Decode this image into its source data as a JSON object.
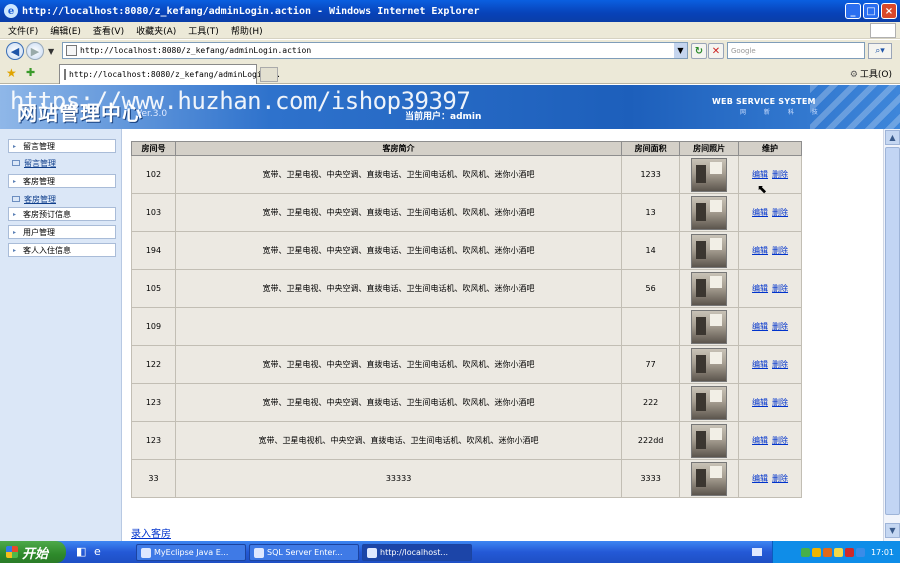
{
  "window": {
    "title": "http://localhost:8080/z_kefang/adminLogin.action - Windows Internet Explorer",
    "minimize": "_",
    "maximize": "□",
    "close": "×"
  },
  "menu": [
    "文件(F)",
    "编辑(E)",
    "查看(V)",
    "收藏夹(A)",
    "工具(T)",
    "帮助(H)"
  ],
  "address": {
    "url": "http://localhost:8080/z_kefang/adminLogin.action",
    "search_placeholder": "Google"
  },
  "tab": {
    "title": "http://localhost:8080/z_kefang/adminLogin...",
    "tools_label": "工具(O)"
  },
  "banner": {
    "title": "网站管理中心",
    "version": "Ver.3.0",
    "watermark": "https://www.huzhan.com/ishop39397",
    "current_user": "当前用户：admin",
    "system_label": "WEB SERVICE SYSTEM",
    "system_sub": "网 新 科 技"
  },
  "sidebar": {
    "items": [
      {
        "label": "留言管理",
        "type": "boxed"
      },
      {
        "label": "留言管理",
        "type": "sub"
      },
      {
        "label": "客房管理",
        "type": "boxed"
      },
      {
        "label": "客房管理",
        "type": "sub"
      },
      {
        "label": "客房预订信息",
        "type": "boxed"
      },
      {
        "label": "用户管理",
        "type": "boxed"
      },
      {
        "label": "客人入住信息",
        "type": "boxed"
      }
    ]
  },
  "table": {
    "headers": [
      "房间号",
      "客房简介",
      "房间面积",
      "房间照片",
      "维护"
    ],
    "edit_label": "编辑",
    "delete_label": "删除",
    "rows": [
      {
        "no": "102",
        "desc": "宽带、卫星电视、中央空调、直拨电话、卫生间电话机、吹风机、迷你小酒吧",
        "area": "1233"
      },
      {
        "no": "103",
        "desc": "宽带、卫星电视、中央空调、直拨电话、卫生间电话机、吹风机、迷你小酒吧",
        "area": "13"
      },
      {
        "no": "194",
        "desc": "宽带、卫星电视、中央空调、直拨电话、卫生间电话机、吹风机、迷你小酒吧",
        "area": "14"
      },
      {
        "no": "105",
        "desc": "宽带、卫星电视、中央空调、直拨电话、卫生间电话机、吹风机、迷你小酒吧",
        "area": "56"
      },
      {
        "no": "109",
        "desc": "",
        "area": ""
      },
      {
        "no": "122",
        "desc": "宽带、卫星电视、中央空调、直拨电话、卫生间电话机、吹风机、迷你小酒吧",
        "area": "77"
      },
      {
        "no": "123",
        "desc": "宽带、卫星电视、中央空调、直拨电话、卫生间电话机、吹风机、迷你小酒吧",
        "area": "222"
      },
      {
        "no": "123",
        "desc": "宽带、卫星电视机、中央空调、直拨电话、卫生间电话机、吹风机、迷你小酒吧",
        "area": "222dd"
      },
      {
        "no": "33",
        "desc": "33333",
        "area": "3333"
      }
    ]
  },
  "add_room_label": "录入客房",
  "taskbar": {
    "start_label": "开始",
    "buttons": [
      "MyEclipse Java E...",
      "SQL Server Enter...",
      "http://localhost..."
    ],
    "clock": "17:01"
  },
  "colors": {
    "banner_blue": "#1d5fbb",
    "sidebar_bg": "#dbe7f7",
    "link_blue": "#0033cc",
    "taskbar_blue": "#2459d6",
    "start_green": "#2e8a2b"
  }
}
